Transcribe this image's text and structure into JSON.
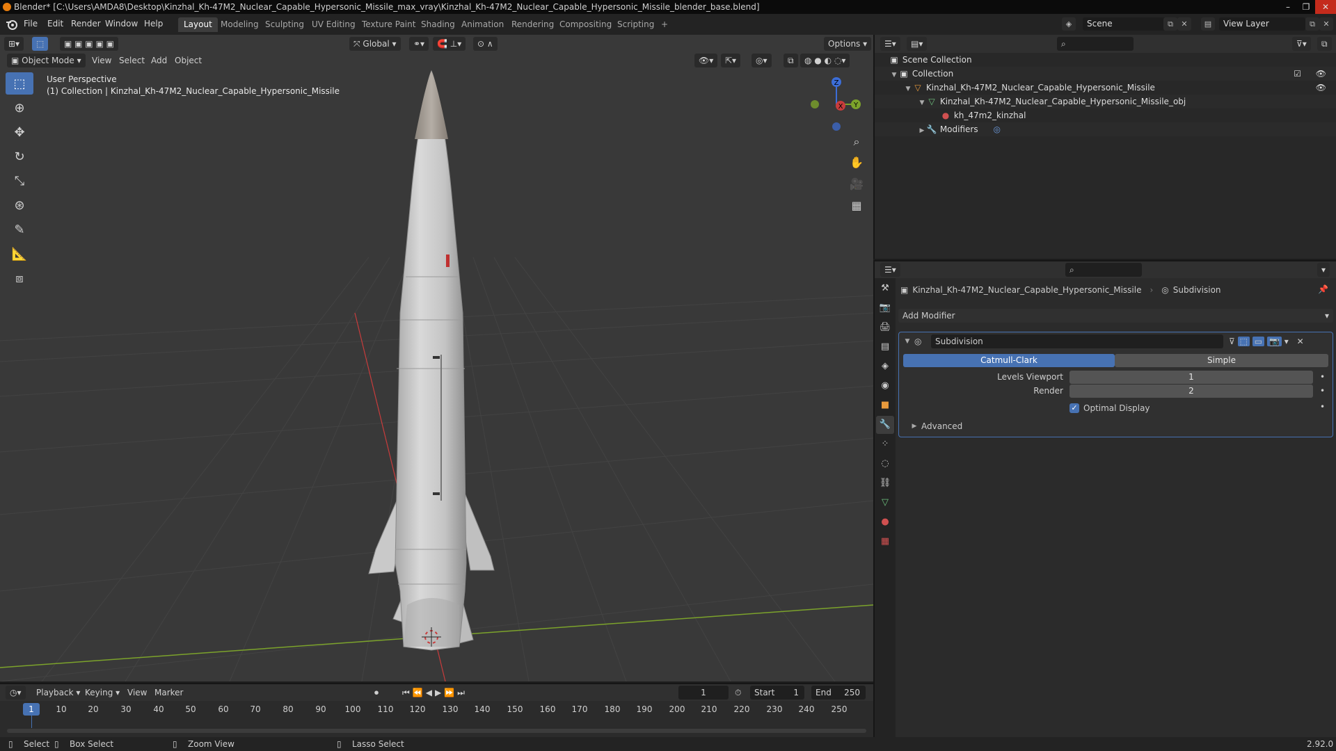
{
  "window": {
    "title": "Blender* [C:\\Users\\AMDA8\\Desktop\\Kinzhal_Kh-47M2_Nuclear_Capable_Hypersonic_Missile_max_vray\\Kinzhal_Kh-47M2_Nuclear_Capable_Hypersonic_Missile_blender_base.blend]",
    "minimize": "–",
    "maximize": "❐",
    "close": "✕"
  },
  "menu": {
    "items": [
      "File",
      "Edit",
      "Render",
      "Window",
      "Help"
    ]
  },
  "workspaces": {
    "tabs": [
      "Layout",
      "Modeling",
      "Sculpting",
      "UV Editing",
      "Texture Paint",
      "Shading",
      "Animation",
      "Rendering",
      "Compositing",
      "Scripting"
    ],
    "active": "Layout",
    "add": "+"
  },
  "scene": {
    "name": "Scene",
    "view_layer": "View Layer"
  },
  "viewport": {
    "orientation": "Global",
    "options_label": "Options",
    "mode": "Object Mode",
    "menus": [
      "View",
      "Select",
      "Add",
      "Object"
    ],
    "info_line1": "User Perspective",
    "info_line2": "(1) Collection | Kinzhal_Kh-47M2_Nuclear_Capable_Hypersonic_Missile",
    "gizmo_axes": {
      "x": "X",
      "y": "Y",
      "z": "Z"
    },
    "colors": {
      "background": "#393939",
      "x_axis": "#c83c3c",
      "y_axis": "#7ca32b",
      "accent": "#4772b3"
    }
  },
  "toolbar": {
    "tools": [
      "select-box-icon",
      "cursor-icon",
      "move-icon",
      "rotate-icon",
      "scale-icon",
      "transform-icon",
      "annotate-icon",
      "measure-icon",
      "add-cube-icon"
    ]
  },
  "outliner": {
    "scene_collection": "Scene Collection",
    "collection": "Collection",
    "object": "Kinzhal_Kh-47M2_Nuclear_Capable_Hypersonic_Missile",
    "mesh": "Kinzhal_Kh-47M2_Nuclear_Capable_Hypersonic_Missile_obj",
    "material": "kh_47m2_kinzhal",
    "modifiers": "Modifiers"
  },
  "properties": {
    "breadcrumb_object": "Kinzhal_Kh-47M2_Nuclear_Capable_Hypersonic_Missile",
    "breadcrumb_modifier": "Subdivision",
    "add_modifier": "Add Modifier",
    "modifier": {
      "name": "Subdivision",
      "type_catmull": "Catmull-Clark",
      "type_simple": "Simple",
      "active_type": "Catmull-Clark",
      "levels_viewport_label": "Levels Viewport",
      "levels_viewport": "1",
      "render_label": "Render",
      "render": "2",
      "optimal_display_label": "Optimal Display",
      "optimal_display": true,
      "advanced_label": "Advanced"
    }
  },
  "timeline": {
    "menus": [
      "Playback",
      "Keying",
      "View",
      "Marker"
    ],
    "current_frame": "1",
    "start_label": "Start",
    "start": "1",
    "end_label": "End",
    "end": "250",
    "ticks": [
      "10",
      "20",
      "30",
      "40",
      "50",
      "60",
      "70",
      "80",
      "90",
      "100",
      "110",
      "120",
      "130",
      "140",
      "150",
      "160",
      "170",
      "180",
      "190",
      "200",
      "210",
      "220",
      "230",
      "240",
      "250"
    ],
    "playhead": "1"
  },
  "statusbar": {
    "select": "Select",
    "box_select": "Box Select",
    "zoom_view": "Zoom View",
    "lasso_select": "Lasso Select",
    "version": "2.92.0"
  }
}
